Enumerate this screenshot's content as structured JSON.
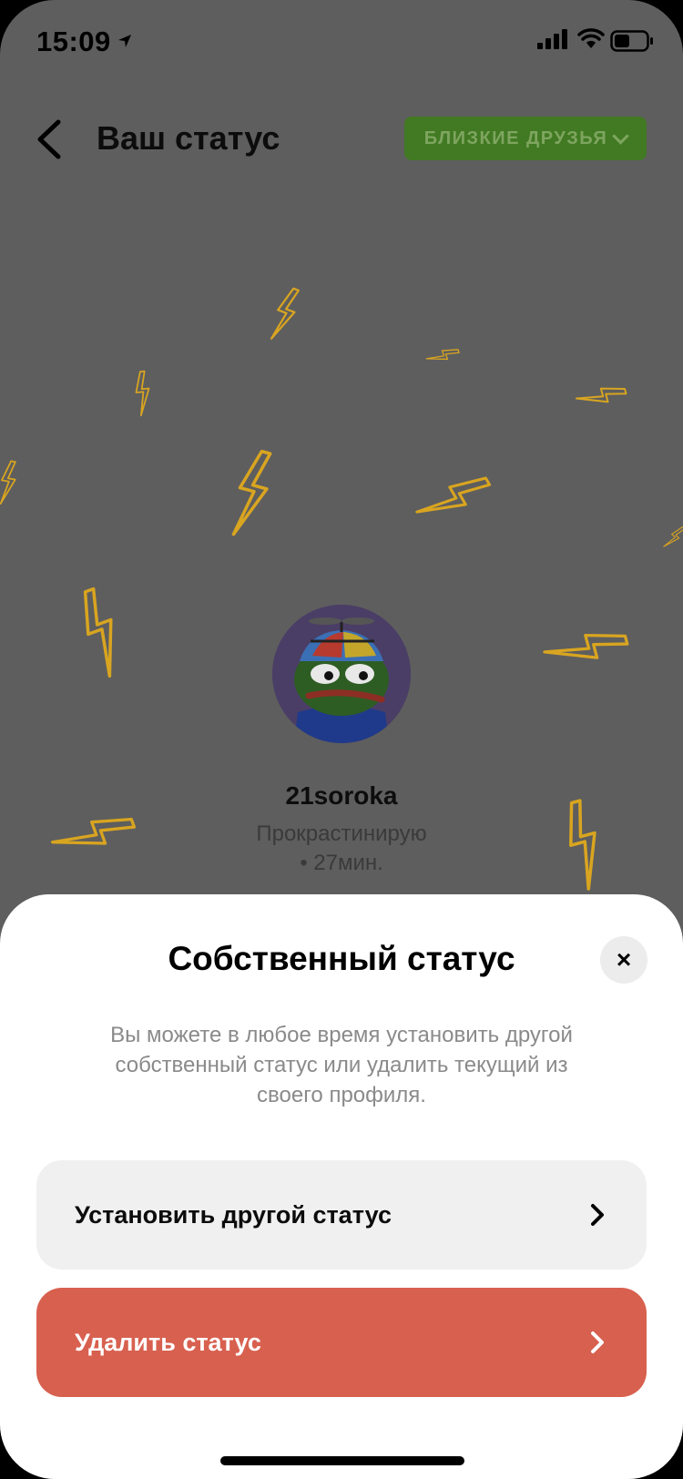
{
  "status_bar": {
    "time": "15:09"
  },
  "header": {
    "title": "Ваш статус",
    "audience_label": "БЛИЗКИЕ ДРУЗЬЯ"
  },
  "profile": {
    "username": "21soroka",
    "status_text": "Прокрастинирую",
    "status_time": "• 27мин."
  },
  "sheet": {
    "title": "Собственный статус",
    "description": "Вы можете в любое время установить другой собственный статус или удалить текущий из своего профиля.",
    "set_status_label": "Установить другой статус",
    "delete_status_label": "Удалить статус",
    "close_icon": "×"
  },
  "colors": {
    "accent_green": "#417a23",
    "danger": "#d8604f",
    "bolt": "#d9a520"
  }
}
